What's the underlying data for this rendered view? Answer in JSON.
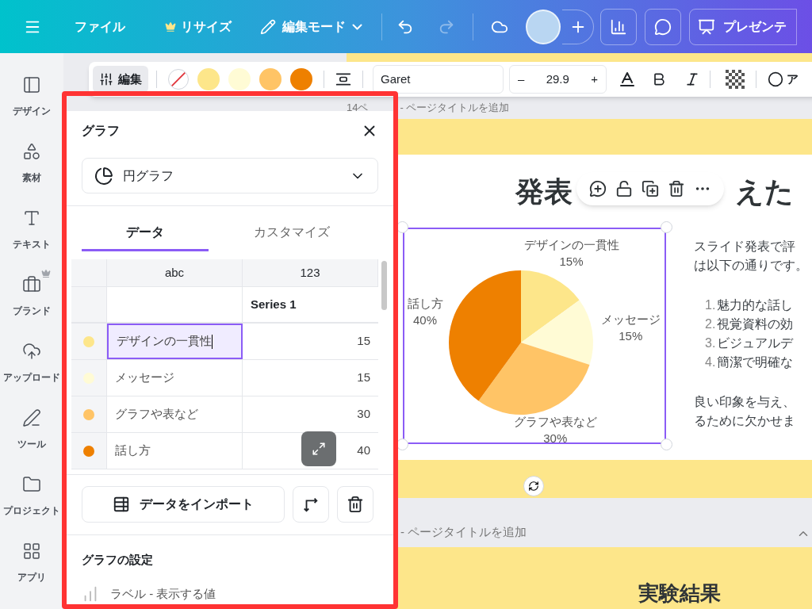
{
  "top_bar": {
    "file_menu": "ファイル",
    "resize": {
      "label": "リサイズ",
      "premium": true
    },
    "edit_mode": "編集モード",
    "undo": {
      "disabled": false
    },
    "redo": {
      "disabled": true
    },
    "present_button": "プレゼンテ"
  },
  "sidebar": {
    "items": [
      {
        "kind": "design",
        "label": "デザイン",
        "premium": false
      },
      {
        "kind": "elements",
        "label": "素材",
        "premium": false
      },
      {
        "kind": "text",
        "label": "テキスト",
        "premium": false
      },
      {
        "kind": "brand",
        "label": "ブランド",
        "premium": true
      },
      {
        "kind": "upload",
        "label": "アップロード",
        "premium": false
      },
      {
        "kind": "tools",
        "label": "ツール",
        "premium": false
      },
      {
        "kind": "projects",
        "label": "プロジェクト",
        "premium": false
      },
      {
        "kind": "apps",
        "label": "アプリ",
        "premium": false
      }
    ]
  },
  "format_toolbar": {
    "edit_button": "編集",
    "swatches": [
      {
        "kind": "none",
        "color": "#ffffff"
      },
      {
        "kind": "color",
        "color": "#fde68a"
      },
      {
        "kind": "color",
        "color": "#fffbd5"
      },
      {
        "kind": "color",
        "color": "#ffc466"
      },
      {
        "kind": "color",
        "color": "#ee8000"
      }
    ],
    "font": "Garet",
    "font_size": {
      "minus": "–",
      "value": "29.9",
      "plus": "+"
    },
    "cut_label": "ア"
  },
  "page_header_1": {
    "page_label": "14ペ",
    "title_placeholder": "- ページタイトルを追加"
  },
  "slide": {
    "title": [
      "発表",
      "えた"
    ],
    "chart": {
      "chart_data": {
        "type": "pie",
        "categories": [
          "デザインの一貫性",
          "メッセージ",
          "グラフや表など",
          "話し方"
        ],
        "values": [
          15,
          15,
          30,
          40
        ],
        "data_labels": "value_labels",
        "value_labels": [
          "15%",
          "15%",
          "30%",
          "40%"
        ]
      }
    },
    "body": [
      {
        "kind": "paragraph",
        "lines": [
          "スライド発表で評",
          "は以下の通りです。"
        ]
      },
      {
        "kind": "list",
        "items": [
          {
            "number": "1.",
            "text": "魅力的な話し"
          },
          {
            "number": "2.",
            "text": "視覚資料の効"
          },
          {
            "number": "3.",
            "text": "ビジュアルデ"
          },
          {
            "number": "4.",
            "text": "簡潔で明確な"
          }
        ]
      },
      {
        "kind": "paragraph",
        "lines": [
          "良い印象を与え、",
          "るために欠かせま"
        ]
      }
    ]
  },
  "page_header_2": {
    "title_placeholder": "- ページタイトルを追加"
  },
  "next_slide": {
    "title": "実験結果"
  },
  "chart_panel": {
    "title": "グラフ",
    "chart_type": "円グラフ",
    "tabs": [
      {
        "label": "データ",
        "selected": true
      },
      {
        "label": "カスタマイズ",
        "selected": false
      }
    ],
    "table": {
      "columns": [
        "abc",
        "123"
      ],
      "series_name": "Series 1",
      "rows": [
        {
          "color": "#fde68a",
          "label": "デザインの一貫性",
          "value": "15",
          "selected": true
        },
        {
          "color": "#fffbd5",
          "label": "メッセージ",
          "value": "15",
          "selected": false
        },
        {
          "color": "#ffc466",
          "label": "グラフや表など",
          "value": "30",
          "selected": false
        },
        {
          "color": "#ee8000",
          "label": "話し方",
          "value": "40",
          "selected": false
        }
      ]
    },
    "import_button": "データをインポート",
    "settings_heading": "グラフの設定",
    "settings_item": "ラベル - 表示する値"
  }
}
